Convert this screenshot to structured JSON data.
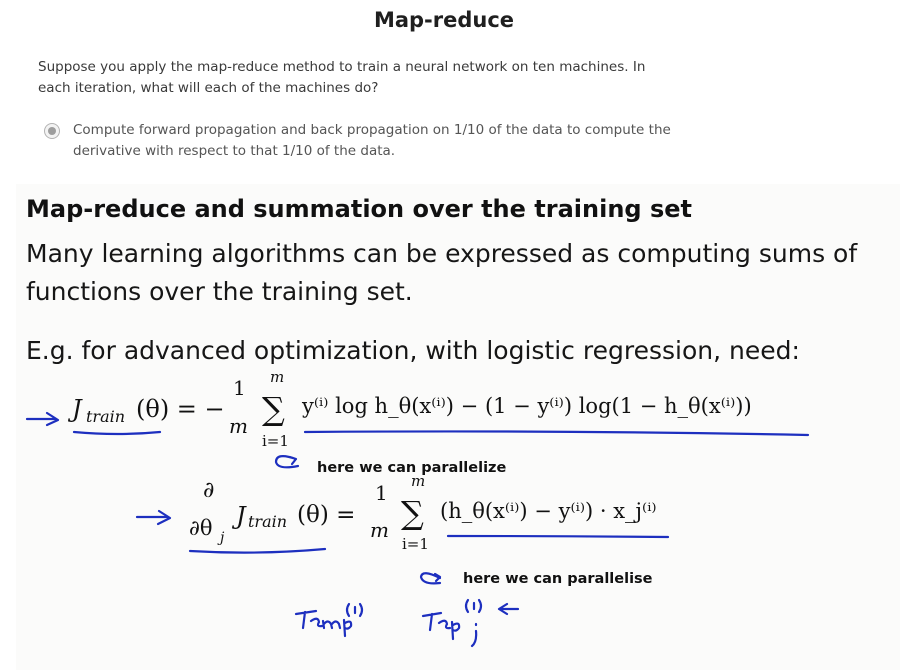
{
  "quiz": {
    "title": "Map-reduce",
    "question": "Suppose you apply the map-reduce method to train a neural network on ten machines. In each iteration, what will each of the machines do?",
    "option_text": "Compute forward propagation and back propagation on 1/10 of the data to compute the derivative with respect to that 1/10 of the data."
  },
  "slide": {
    "title": "Map-reduce and summation over the training set",
    "text": "Many learning algorithms can be expressed as computing sums of functions over the training set.",
    "example": "E.g. for advanced optimization, with logistic regression, need:",
    "eq1": {
      "lhs": "J",
      "lhs_sub": "train",
      "lhs_arg": "(θ) = −",
      "frac_num": "1",
      "frac_den": "m",
      "sum_top": "m",
      "sum_bottom": "i=1",
      "body": "y⁽ⁱ⁾ log h_θ(x⁽ⁱ⁾) − (1 − y⁽ⁱ⁾) log(1 − h_θ(x⁽ⁱ⁾))"
    },
    "eq2": {
      "partial_num": "∂",
      "partial_den": "∂θ",
      "partial_den_sub": "j",
      "lhs": "J",
      "lhs_sub": "train",
      "lhs_arg": "(θ) =",
      "frac_num": "1",
      "frac_den": "m",
      "sum_top": "m",
      "sum_bottom": "i=1",
      "body": "(h_θ(x⁽ⁱ⁾) − y⁽ⁱ⁾) · x_j⁽ⁱ⁾"
    }
  },
  "annotations": {
    "note1": "here we can parallelize",
    "note2": "here we can parallelise",
    "handwritten": [
      "temp⁽ⁱ⁾",
      "temp⁽ⁱ⁾ⱼ"
    ]
  },
  "colors": {
    "pen": "#1d2fbf",
    "radio": "#9d9d9d"
  }
}
